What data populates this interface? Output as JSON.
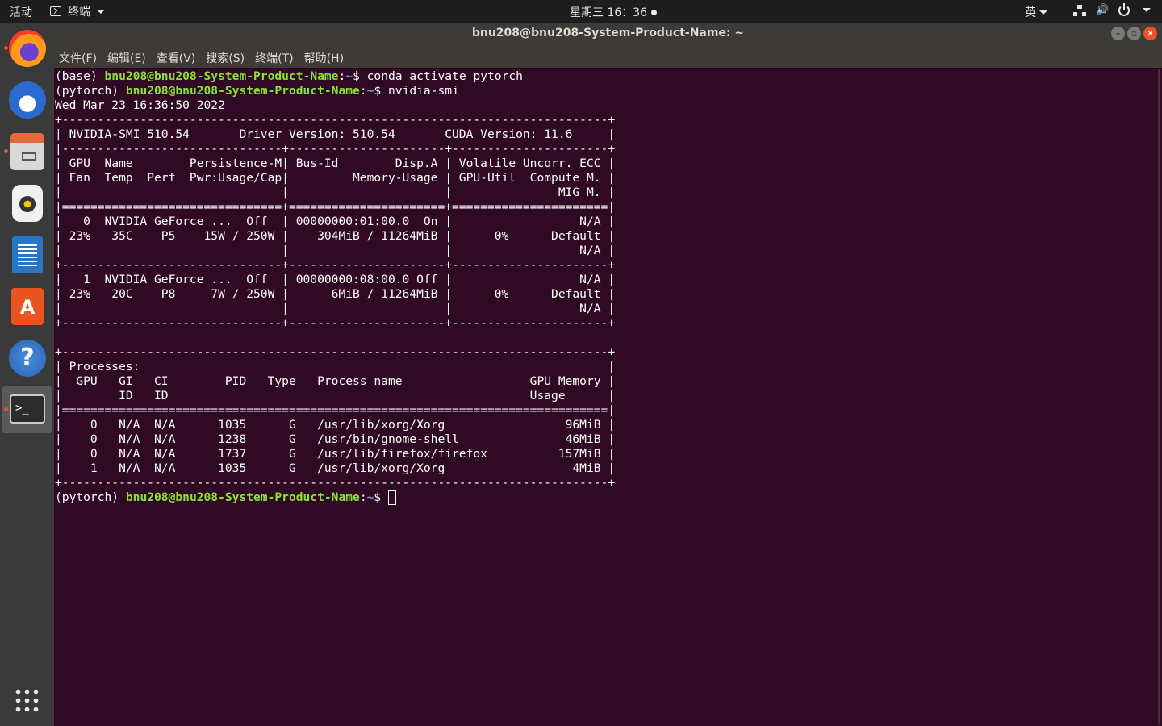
{
  "topbar": {
    "activities": "活动",
    "app_menu": "终端",
    "clock": "星期三 16：36",
    "input_method": "英"
  },
  "dock": {
    "items": [
      "firefox-icon",
      "thunderbird-icon",
      "files-icon",
      "rhythmbox-icon",
      "libreoffice-writer-icon",
      "ubuntu-software-icon",
      "help-icon",
      "terminal-icon"
    ],
    "help_glyph": "?",
    "software_glyph": "A",
    "terminal_glyph": ">_"
  },
  "window": {
    "title": "bnu208@bnu208-System-Product-Name: ~",
    "menus": {
      "file": "文件(F)",
      "edit": "编辑(E)",
      "view": "查看(V)",
      "search": "搜索(S)",
      "terminal": "终端(T)",
      "help": "帮助(H)"
    }
  },
  "terminal": {
    "prompt1": {
      "env": "(base) ",
      "user": "bnu208@bnu208-System-Product-Name",
      "colon": ":",
      "path": "~",
      "dollar": "$ ",
      "cmd": "conda activate pytorch"
    },
    "prompt2": {
      "env": "(pytorch) ",
      "user": "bnu208@bnu208-System-Product-Name",
      "colon": ":",
      "path": "~",
      "dollar": "$ ",
      "cmd": "nvidia-smi"
    },
    "output": [
      "Wed Mar 23 16:36:50 2022",
      "+-----------------------------------------------------------------------------+",
      "| NVIDIA-SMI 510.54       Driver Version: 510.54       CUDA Version: 11.6     |",
      "|-------------------------------+----------------------+----------------------+",
      "| GPU  Name        Persistence-M| Bus-Id        Disp.A | Volatile Uncorr. ECC |",
      "| Fan  Temp  Perf  Pwr:Usage/Cap|         Memory-Usage | GPU-Util  Compute M. |",
      "|                               |                      |               MIG M. |",
      "|===============================+======================+======================|",
      "|   0  NVIDIA GeForce ...  Off  | 00000000:01:00.0  On |                  N/A |",
      "| 23%   35C    P5    15W / 250W |    304MiB / 11264MiB |      0%      Default |",
      "|                               |                      |                  N/A |",
      "+-------------------------------+----------------------+----------------------+",
      "|   1  NVIDIA GeForce ...  Off  | 00000000:08:00.0 Off |                  N/A |",
      "| 23%   20C    P8     7W / 250W |      6MiB / 11264MiB |      0%      Default |",
      "|                               |                      |                  N/A |",
      "+-------------------------------+----------------------+----------------------+",
      "",
      "+-----------------------------------------------------------------------------+",
      "| Processes:                                                                  |",
      "|  GPU   GI   CI        PID   Type   Process name                  GPU Memory |",
      "|        ID   ID                                                   Usage      |",
      "|=============================================================================|",
      "|    0   N/A  N/A      1035      G   /usr/lib/xorg/Xorg                 96MiB |",
      "|    0   N/A  N/A      1238      G   /usr/bin/gnome-shell               46MiB |",
      "|    0   N/A  N/A      1737      G   /usr/lib/firefox/firefox          157MiB |",
      "|    1   N/A  N/A      1035      G   /usr/lib/xorg/Xorg                  4MiB |",
      "+-----------------------------------------------------------------------------+"
    ],
    "prompt3": {
      "env": "(pytorch) ",
      "user": "bnu208@bnu208-System-Product-Name",
      "colon": ":",
      "path": "~",
      "dollar": "$ "
    }
  },
  "colors": {
    "terminal_bg": "#300a24",
    "prompt_user": "#8ae234",
    "prompt_path": "#729fcf",
    "accent": "#e95420"
  }
}
